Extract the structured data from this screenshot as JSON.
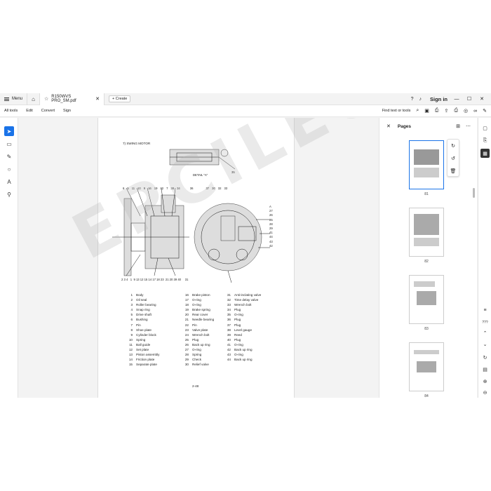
{
  "titlebar": {
    "menu_label": "Menu",
    "tab_title": "R150WVS PRO_SM.pdf",
    "create_label": "Create",
    "sign_in": "Sign in"
  },
  "menubar": {
    "items": [
      "All tools",
      "Edit",
      "Convert",
      "Sign"
    ],
    "find_label": "Find text or tools"
  },
  "document": {
    "section_title": "7) SWING MOTOR",
    "detail_label": "DETAIL \"A\"",
    "page_number": "2-48",
    "watermark": "EPCILEO.COM",
    "callouts_top": [
      "6",
      "5",
      "11",
      "10",
      "9",
      "16",
      "19",
      "22",
      "7",
      "38",
      "34",
      "36",
      "37",
      "30",
      "32",
      "33"
    ],
    "callouts_bottom": "2 3 4   1  9 13 12 15 14 17 18 23  21 20 39 40     31",
    "callouts_right": [
      "A",
      "27",
      "26",
      "25",
      "28",
      "29",
      "41",
      "44",
      "43",
      "42"
    ],
    "detail_callout": "35",
    "parts": [
      [
        [
          "1",
          "Body"
        ],
        [
          "2",
          "Oil seal"
        ],
        [
          "3",
          "Roller bearing"
        ],
        [
          "4",
          "Snap ring"
        ],
        [
          "5",
          "Drive shaft"
        ],
        [
          "6",
          "Bushing"
        ],
        [
          "7",
          "Pin"
        ],
        [
          "8",
          "Shoe plate"
        ],
        [
          "9",
          "Cylinder block"
        ],
        [
          "10",
          "Spring"
        ],
        [
          "11",
          "Ball guide"
        ],
        [
          "12",
          "Set plate"
        ],
        [
          "13",
          "Piston assembly"
        ],
        [
          "14",
          "Friction plate"
        ],
        [
          "15",
          "Separate plate"
        ]
      ],
      [
        [
          "16",
          "Brake piston"
        ],
        [
          "17",
          "O-ring"
        ],
        [
          "18",
          "O-ring"
        ],
        [
          "19",
          "Brake spring"
        ],
        [
          "20",
          "Rear cover"
        ],
        [
          "21",
          "Needle bearing"
        ],
        [
          "22",
          "Pin"
        ],
        [
          "23",
          "Valve plate"
        ],
        [
          "24",
          "Wrench bolt"
        ],
        [
          "25",
          "Plug"
        ],
        [
          "26",
          "Back up ring"
        ],
        [
          "27",
          "O-ring"
        ],
        [
          "28",
          "Spring"
        ],
        [
          "29",
          "Check"
        ],
        [
          "30",
          "Relief valve"
        ]
      ],
      [
        [
          "31",
          "Anti-inclating valve"
        ],
        [
          "32",
          "Time delay valve"
        ],
        [
          "33",
          "Wrench bolt"
        ],
        [
          "34",
          "Plug"
        ],
        [
          "35",
          "O-ring"
        ],
        [
          "36",
          "Plug"
        ],
        [
          "37",
          "Plug"
        ],
        [
          "38",
          "Level gauge"
        ],
        [
          "39",
          "Reed"
        ],
        [
          "40",
          "Plug"
        ],
        [
          "41",
          "O-ring"
        ],
        [
          "42",
          "Back up ring"
        ],
        [
          "43",
          "O-ring"
        ],
        [
          "44",
          "Back up ring"
        ]
      ]
    ]
  },
  "pages_panel": {
    "title": "Pages",
    "thumbnails": [
      {
        "label": "81",
        "selected": true
      },
      {
        "label": "82",
        "selected": false
      },
      {
        "label": "83",
        "selected": false
      },
      {
        "label": "84",
        "selected": false
      }
    ]
  },
  "right_rail": {
    "zoom_text": "???"
  },
  "colors": {
    "accent": "#1a73e8",
    "background": "#f3f3f3"
  },
  "icons": [
    "hamburger-icon",
    "home-icon",
    "star-icon",
    "close-icon",
    "plus-icon",
    "help-icon",
    "bell-icon",
    "minimize-icon",
    "maximize-icon",
    "search-icon",
    "save-icon",
    "print-icon",
    "share-icon",
    "cursor-icon",
    "comment-icon",
    "pen-icon",
    "lasso-icon",
    "text-select-icon",
    "stamp-icon",
    "rotate-icon",
    "undo-icon",
    "trash-icon"
  ]
}
